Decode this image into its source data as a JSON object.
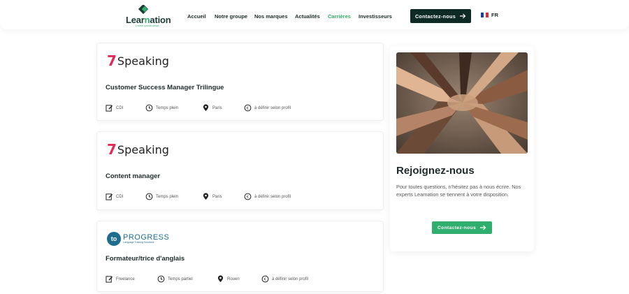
{
  "header": {
    "logo": {
      "text_a": "Lear",
      "text_n": "n",
      "text_b": "ation",
      "tagline": "Lorem ipsum dolor"
    },
    "nav": [
      "Accueil",
      "Notre groupe",
      "Nos marques",
      "Actualités",
      "Carrières",
      "Investisseurs"
    ],
    "active_nav": "Carrières",
    "cta_label": "Contactez-nous",
    "lang_label": "FR"
  },
  "jobs": [
    {
      "brand": "7Speaking",
      "brand_mark": "7",
      "brand_word": "Speaking",
      "title": "Customer Success Manager Trilingue",
      "contract": "CDI",
      "schedule": "Temps plein",
      "location": "Paris",
      "salary": "à définir selon profil"
    },
    {
      "brand": "7Speaking",
      "brand_mark": "7",
      "brand_word": "Speaking",
      "title": "Content manager",
      "contract": "CDI",
      "schedule": "Temps plein",
      "location": "Paris",
      "salary": "à définir selon profil"
    },
    {
      "brand": "to PROGRESS",
      "brand_mark": "to",
      "brand_word": "PROGRESS",
      "brand_sub": "Language Training Solutions",
      "title": "Formateur/trice d'anglais",
      "contract": "Freelance",
      "schedule": "Temps partiel",
      "location": "Rouen",
      "salary": "à définir selon profil"
    }
  ],
  "sidebar": {
    "title": "Rejoignez-nous",
    "text": "Pour toutes questions, n'hésitez pas à nous écrire. Nos experts Learnation se tiennent à votre disposition.",
    "cta_label": "Contactez-nous"
  },
  "colors": {
    "dark": "#0e2a24",
    "accent": "#2fae6e",
    "speaking_red": "#e4285a",
    "progress_blue": "#1e6c8e"
  }
}
